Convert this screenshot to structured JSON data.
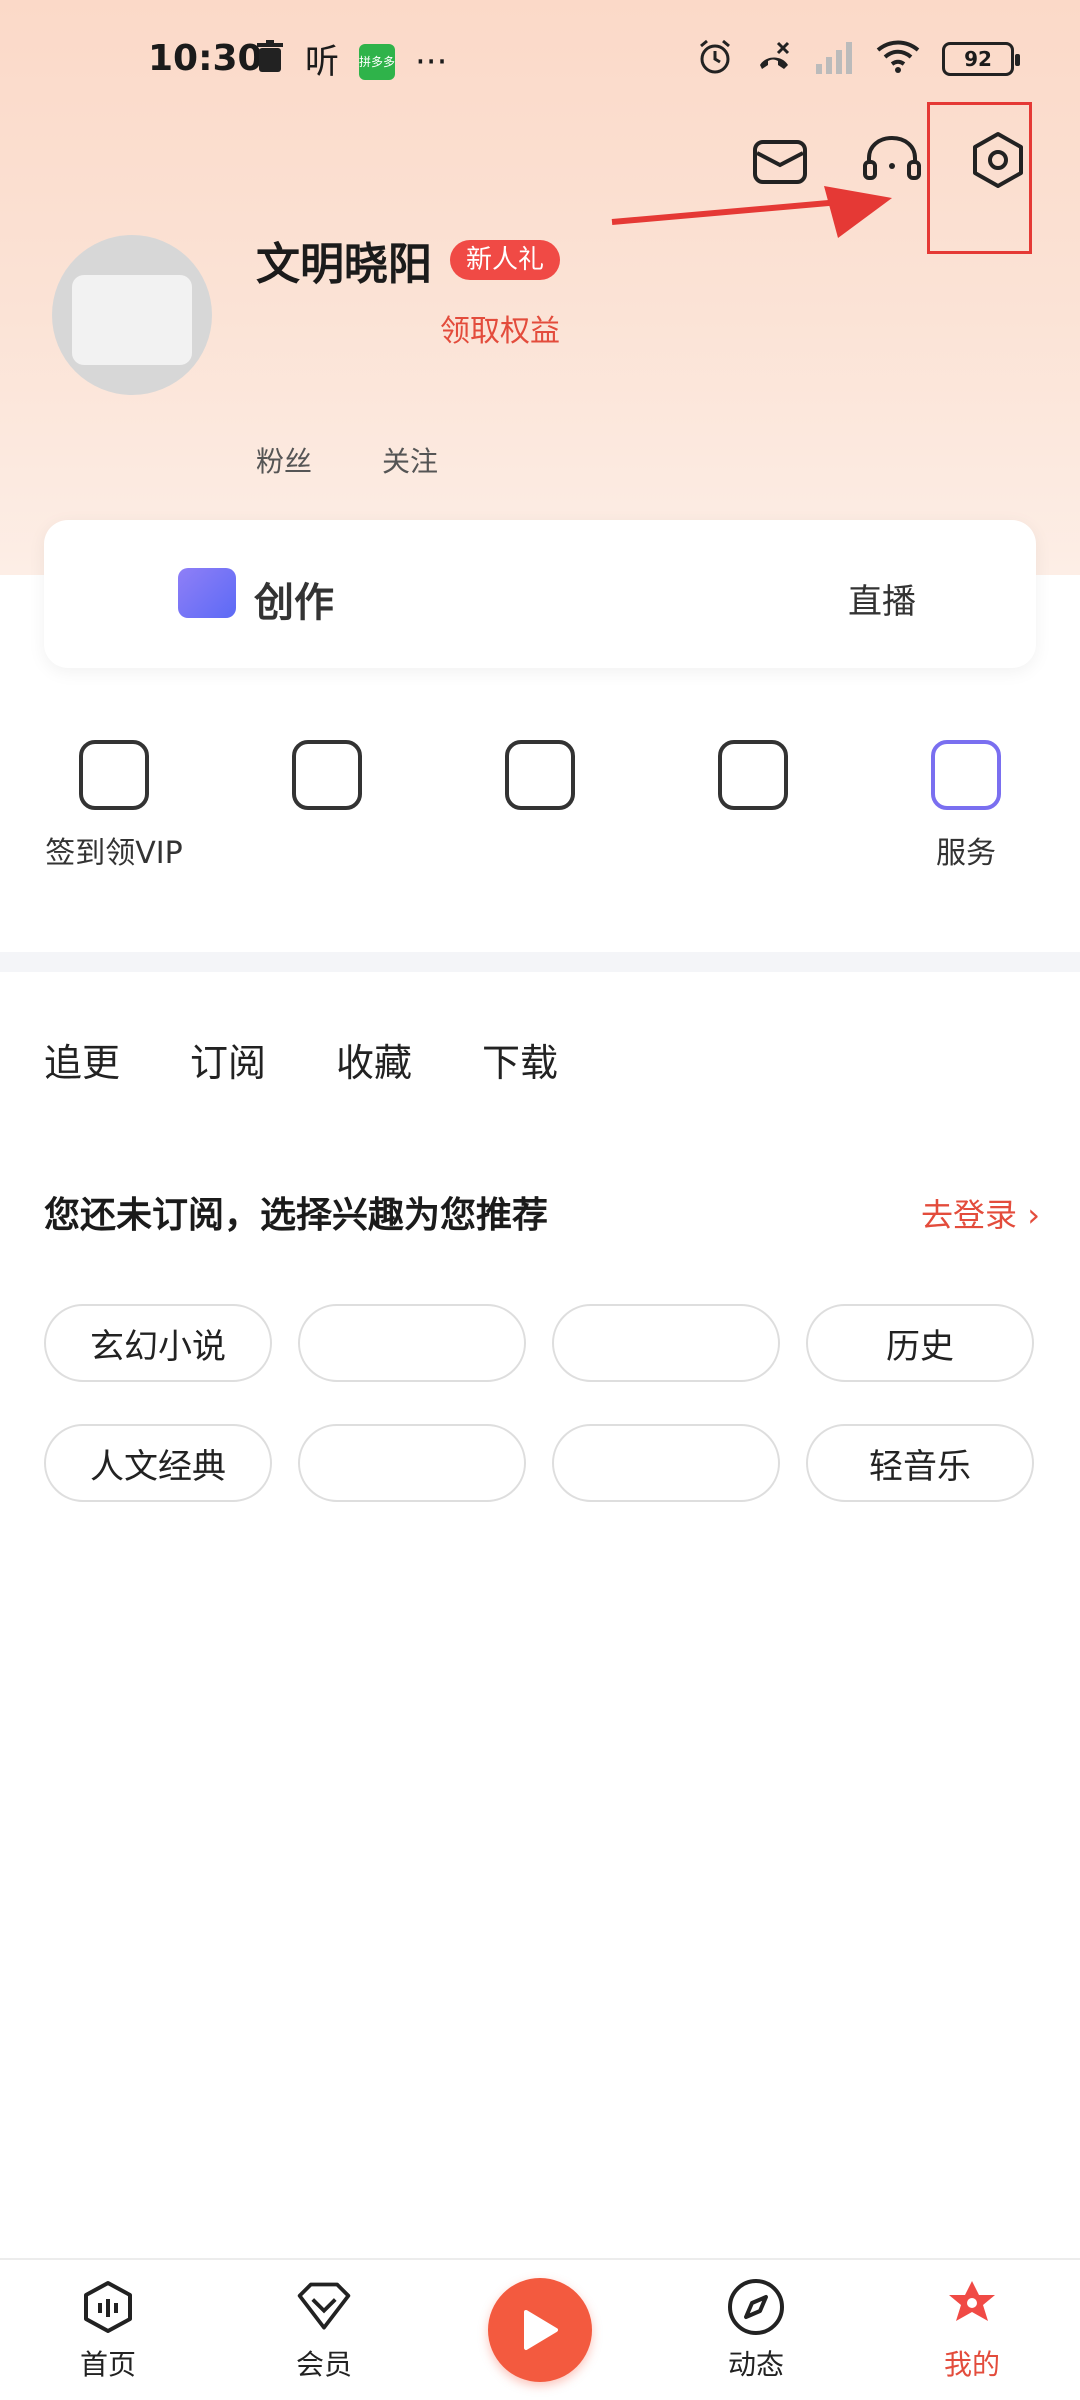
{
  "status_bar": {
    "time": "10:30",
    "ting_glyph": "听",
    "app_badge": "拼多多",
    "more": "···",
    "battery": "92"
  },
  "profile": {
    "username": "文明晓阳",
    "newbie_badge": "新人礼",
    "benefit_link": "领取权益",
    "stats": [
      {
        "value": "",
        "label": "粉丝"
      },
      {
        "value": "",
        "label": "关注"
      }
    ]
  },
  "creator": {
    "label": "创作",
    "link": "直播"
  },
  "quick_actions": [
    {
      "label": "签到领VIP",
      "icon": "gift-icon"
    },
    {
      "label": "",
      "icon": "wallet-icon"
    },
    {
      "label": "",
      "icon": "card-icon"
    },
    {
      "label": "",
      "icon": "bag-icon"
    },
    {
      "label": "服务",
      "icon": "apps-icon"
    }
  ],
  "tabs": [
    "追更",
    "订阅",
    "收藏",
    "下载"
  ],
  "recommend": {
    "title": "您还未订阅，选择兴趣为您推荐",
    "login_link": "去登录"
  },
  "chips": [
    "玄幻小说",
    "",
    "",
    "历史",
    "人文经典",
    "",
    "",
    "轻音乐"
  ],
  "bottom_nav": [
    {
      "label": "首页",
      "icon": "home-icon"
    },
    {
      "label": "会员",
      "icon": "vip-icon"
    },
    {
      "label": "",
      "icon": "play-icon"
    },
    {
      "label": "动态",
      "icon": "dynamic-icon"
    },
    {
      "label": "我的",
      "icon": "mine-icon"
    }
  ],
  "colors": {
    "accent": "#e34c3c",
    "header_bg": "#fbd9c8",
    "annotation_red": "#e53935"
  }
}
